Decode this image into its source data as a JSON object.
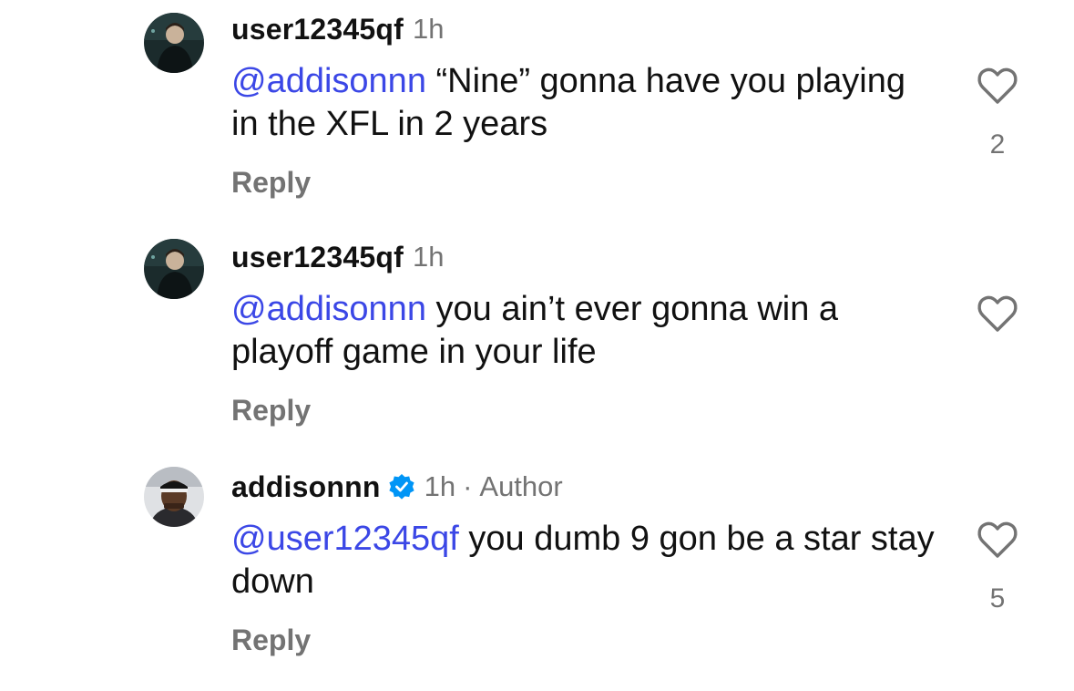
{
  "comments": [
    {
      "username": "user12345qf",
      "time": "1h",
      "mention": "@addisonnn",
      "text": " “Nine” gonna have you playing in the XFL in 2 years",
      "reply_label": "Reply",
      "likes": "2",
      "avatar_icon": "dark-portrait-avatar"
    },
    {
      "username": "user12345qf",
      "time": "1h",
      "mention": "@addisonnn",
      "text": " you ain’t ever gonna win a playoff game in your life",
      "reply_label": "Reply",
      "avatar_icon": "dark-portrait-avatar"
    },
    {
      "username": "addisonnn",
      "time": "1h",
      "separator": "·",
      "author_label": "Author",
      "verified_icon": "verified-badge-icon",
      "mention": "@user12345qf",
      "text": " you dumb 9 gon be a star stay down",
      "reply_label": "Reply",
      "likes": "5",
      "avatar_icon": "player-headband-avatar"
    }
  ],
  "colors": {
    "mention": "#3b47e6",
    "secondary_text": "#737373",
    "verified": "#0095f6"
  }
}
